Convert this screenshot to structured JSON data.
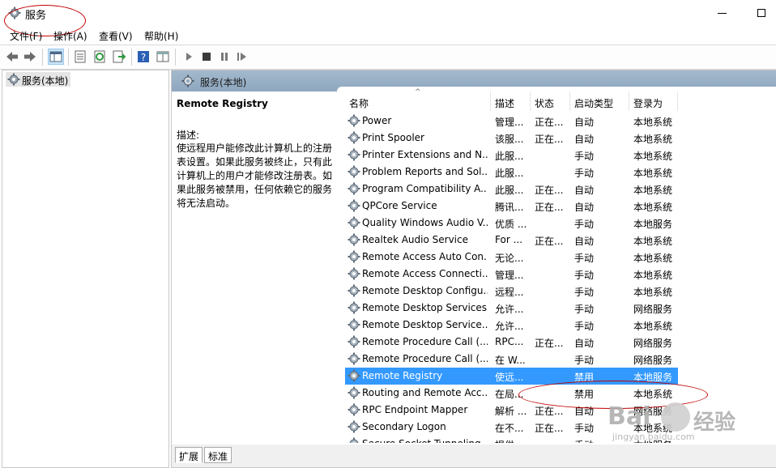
{
  "window": {
    "title": "服务"
  },
  "menu": [
    "文件(F)",
    "操作(A)",
    "查看(V)",
    "帮助(H)"
  ],
  "toolbar": {
    "icons": [
      "back-arrow-icon",
      "forward-arrow-icon",
      "console-tree-icon",
      "properties-icon",
      "refresh-icon",
      "export-list-icon",
      "help-icon",
      "show-hide-pane-icon",
      "start-service-icon",
      "stop-service-icon",
      "pause-service-icon",
      "restart-service-icon"
    ]
  },
  "tree": {
    "node_label": "服务(本地)"
  },
  "pane": {
    "header_title": "服务(本地)"
  },
  "description": {
    "service_name": "Remote Registry",
    "label": "描述:",
    "text": "使远程用户能修改此计算机上的注册表设置。如果此服务被终止，只有此计算机上的用户才能修改注册表。如果此服务被禁用，任何依赖它的服务将无法启动。"
  },
  "table": {
    "headers": {
      "name": "名称",
      "description": "描述",
      "status": "状态",
      "startup": "启动类型",
      "logon": "登录为"
    },
    "rows": [
      {
        "name": "Power",
        "description": "管理...",
        "status": "正在...",
        "startup": "自动",
        "logon": "本地系统"
      },
      {
        "name": "Print Spooler",
        "description": "该服...",
        "status": "正在...",
        "startup": "自动",
        "logon": "本地系统"
      },
      {
        "name": "Printer Extensions and N...",
        "description": "此服...",
        "status": "",
        "startup": "手动",
        "logon": "本地系统"
      },
      {
        "name": "Problem Reports and Sol...",
        "description": "此服...",
        "status": "",
        "startup": "手动",
        "logon": "本地系统"
      },
      {
        "name": "Program Compatibility A...",
        "description": "此服...",
        "status": "正在...",
        "startup": "自动",
        "logon": "本地系统"
      },
      {
        "name": "QPCore Service",
        "description": "腾讯...",
        "status": "正在...",
        "startup": "自动",
        "logon": "本地系统"
      },
      {
        "name": "Quality Windows Audio V...",
        "description": "优质 ...",
        "status": "",
        "startup": "手动",
        "logon": "本地服务"
      },
      {
        "name": "Realtek Audio Service",
        "description": "For ...",
        "status": "正在...",
        "startup": "自动",
        "logon": "本地系统"
      },
      {
        "name": "Remote Access Auto Con...",
        "description": "无论...",
        "status": "",
        "startup": "手动",
        "logon": "本地系统"
      },
      {
        "name": "Remote Access Connecti...",
        "description": "管理...",
        "status": "",
        "startup": "手动",
        "logon": "本地系统"
      },
      {
        "name": "Remote Desktop Configu...",
        "description": "远程...",
        "status": "",
        "startup": "手动",
        "logon": "本地系统"
      },
      {
        "name": "Remote Desktop Services",
        "description": "允许...",
        "status": "",
        "startup": "手动",
        "logon": "网络服务"
      },
      {
        "name": "Remote Desktop Service...",
        "description": "允许...",
        "status": "",
        "startup": "手动",
        "logon": "本地系统"
      },
      {
        "name": "Remote Procedure Call (...",
        "description": "RPC...",
        "status": "正在...",
        "startup": "自动",
        "logon": "网络服务"
      },
      {
        "name": "Remote Procedure Call (...",
        "description": "在 W...",
        "status": "",
        "startup": "手动",
        "logon": "网络服务"
      },
      {
        "name": "Remote Registry",
        "description": "使远...",
        "status": "",
        "startup": "禁用",
        "logon": "本地服务",
        "selected": true
      },
      {
        "name": "Routing and Remote Acc...",
        "description": "在局...",
        "status": "",
        "startup": "禁用",
        "logon": "本地系统"
      },
      {
        "name": "RPC Endpoint Mapper",
        "description": "解析 ...",
        "status": "正在...",
        "startup": "自动",
        "logon": "网络服务"
      },
      {
        "name": "Secondary Logon",
        "description": "在不...",
        "status": "正在...",
        "startup": "手动",
        "logon": "本地系统"
      },
      {
        "name": "Secure Socket Tunneling ...",
        "description": "提供...",
        "status": "",
        "startup": "手动",
        "logon": "本地服务"
      }
    ]
  },
  "tabs": [
    "扩展",
    "标准"
  ],
  "watermark": {
    "text": "Bai",
    "url": "jingyan.baidu.com",
    "suffix": "经验"
  }
}
